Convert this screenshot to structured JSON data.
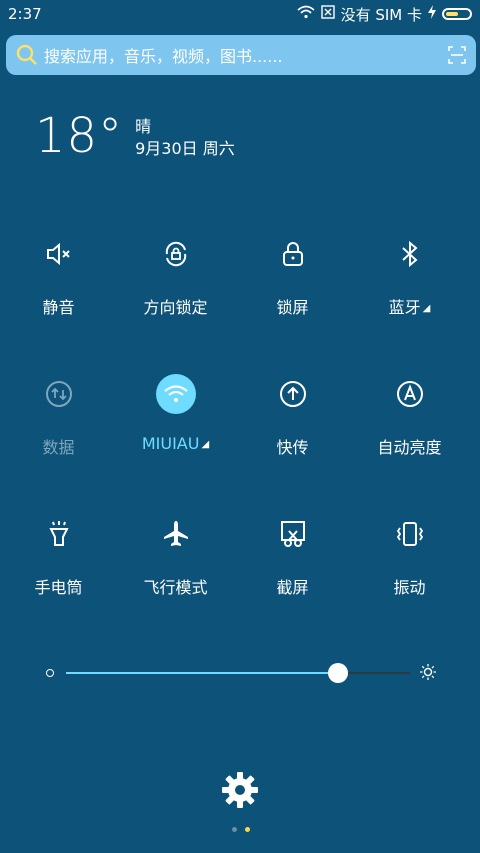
{
  "status_bar": {
    "time": "2:37",
    "sim_text": "没有 SIM 卡"
  },
  "search": {
    "placeholder": "搜索应用，音乐，视频，图书......"
  },
  "weather": {
    "temperature": "18°",
    "condition": "晴",
    "date": "9月30日 周六"
  },
  "tiles": {
    "row1": [
      {
        "label": "静音",
        "icon": "mute-icon"
      },
      {
        "label": "方向锁定",
        "icon": "rotation-lock-icon"
      },
      {
        "label": "锁屏",
        "icon": "lock-icon"
      },
      {
        "label": "蓝牙",
        "icon": "bluetooth-icon"
      }
    ],
    "row2": [
      {
        "label": "数据",
        "icon": "data-icon"
      },
      {
        "label": "MIUIAU",
        "icon": "wifi-icon"
      },
      {
        "label": "快传",
        "icon": "quick-transfer-icon"
      },
      {
        "label": "自动亮度",
        "icon": "auto-brightness-icon"
      }
    ],
    "row3": [
      {
        "label": "手电筒",
        "icon": "flashlight-icon"
      },
      {
        "label": "飞行模式",
        "icon": "airplane-icon"
      },
      {
        "label": "截屏",
        "icon": "screenshot-icon"
      },
      {
        "label": "振动",
        "icon": "vibrate-icon"
      }
    ]
  },
  "brightness": {
    "level": 0.79
  },
  "colors": {
    "background": "#0d5278",
    "accent": "#6fdcff",
    "search_bg": "#7ec6f0"
  },
  "pagination": {
    "pages": 2,
    "current": 2
  }
}
